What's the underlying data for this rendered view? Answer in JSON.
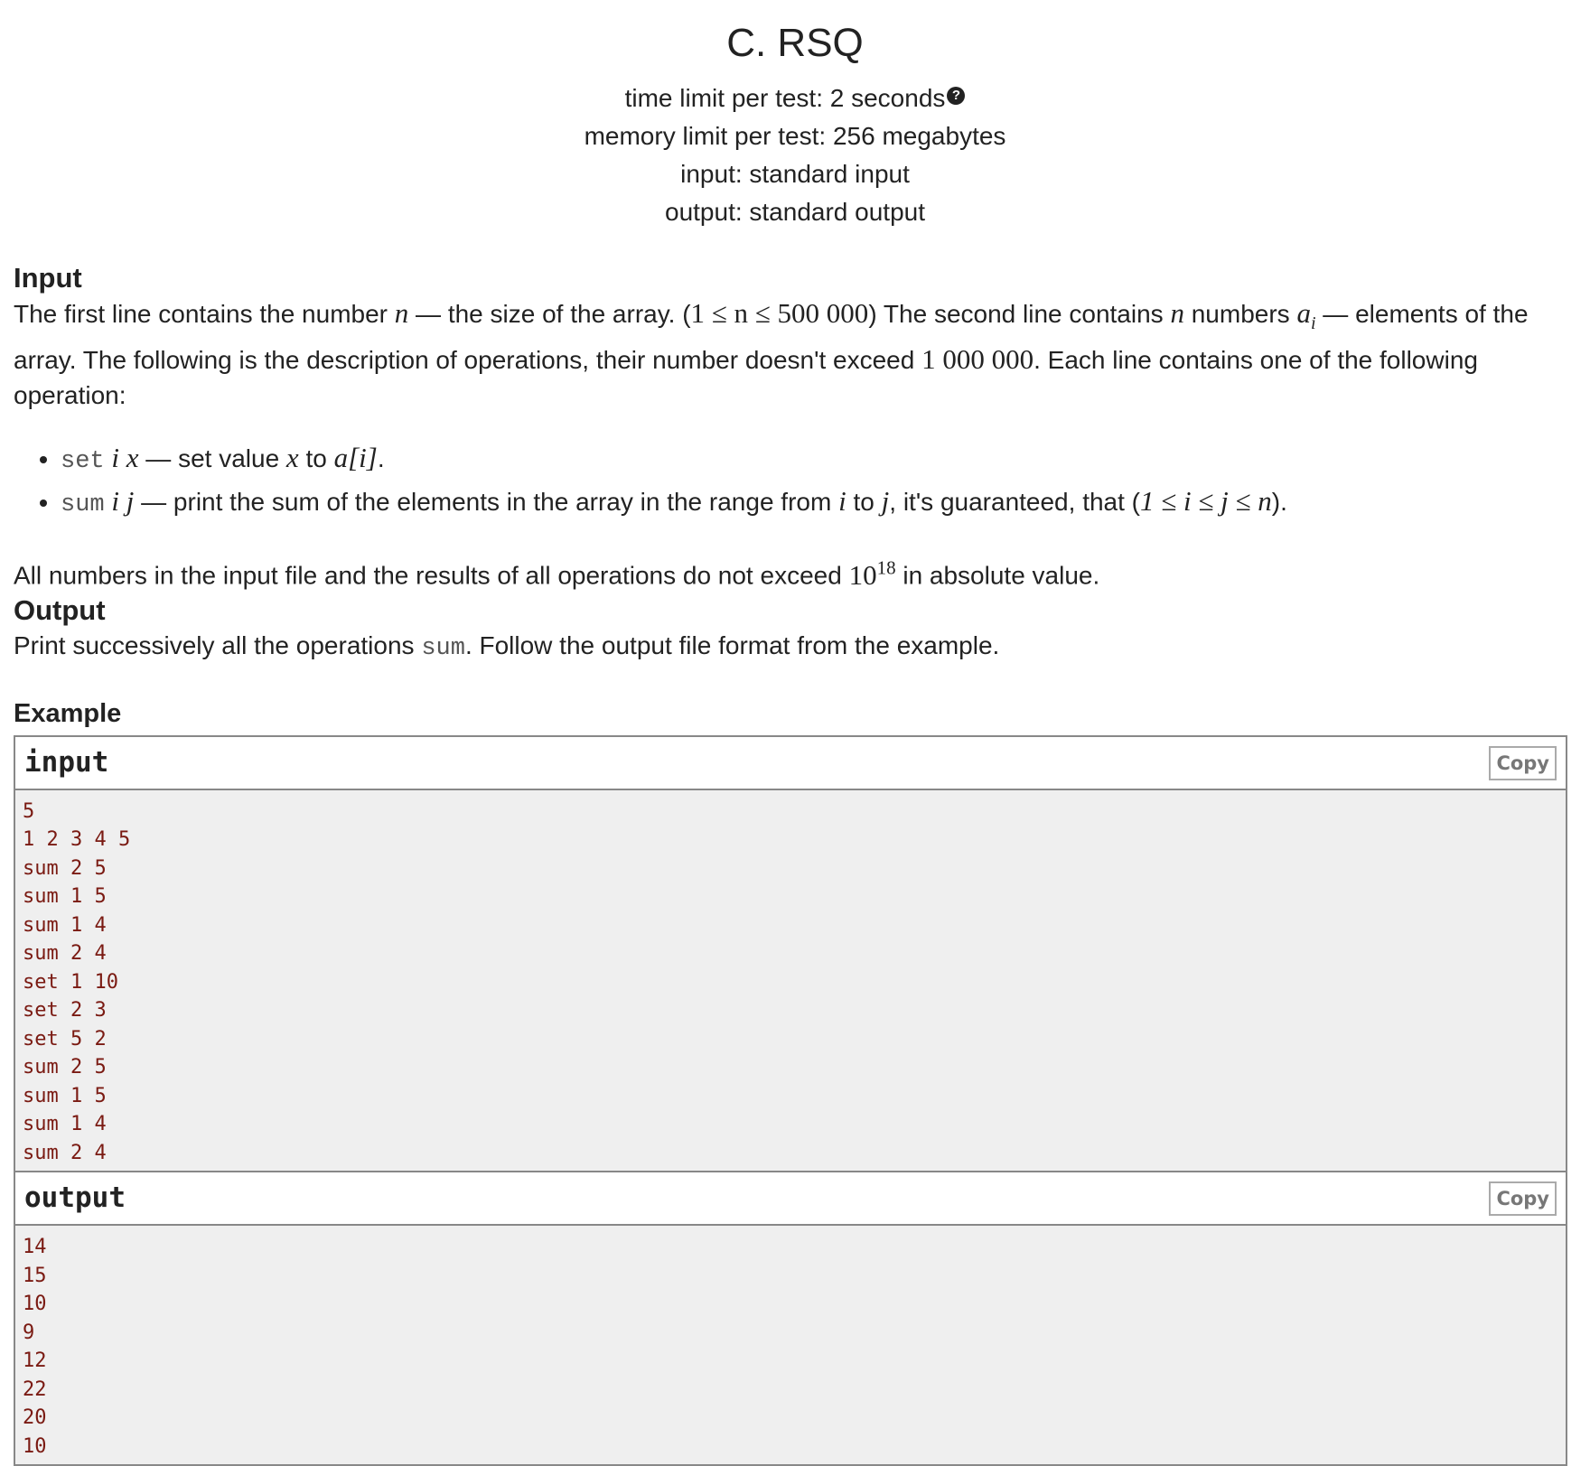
{
  "problem": {
    "title": "C. RSQ",
    "limits": {
      "time": "time limit per test: 2 seconds",
      "memory": "memory limit per test: 256 megabytes",
      "input": "input: standard input",
      "output": "output: standard output"
    },
    "help_icon": "question-circle-icon"
  },
  "input_section": {
    "title": "Input",
    "p1_a": "The first line contains the number ",
    "p1_b": " — the size of the array. (",
    "p1_c": ") The second line contains ",
    "p1_d": " numbers ",
    "p1_e": " — elements of the array. The following is the description of operations, their number doesn't exceed ",
    "p1_f": ". Each line contains one of the following operation:",
    "math_n": "n",
    "math_range": "1 ≤ n ≤ 500 000",
    "math_ai_base": "a",
    "math_ai_sub": "i",
    "math_limit": "1 000 000",
    "op1_cmd": "set",
    "op1_vars": "i x",
    "op1_text_a": " — set value ",
    "op1_x": "x",
    "op1_text_b": " to ",
    "op1_expr": "a[i]",
    "op1_end": ".",
    "op2_cmd": "sum",
    "op2_vars": "i j",
    "op2_text_a": " — print the sum of the elements in the array in the range from ",
    "op2_i": "i",
    "op2_text_b": " to ",
    "op2_j": "j",
    "op2_text_c": ", it's guaranteed, that (",
    "op2_cond": "1 ≤ i ≤ j ≤ n",
    "op2_end": ").",
    "p2_a": "All numbers in the input file and the results of all operations do not exceed ",
    "p2_base": "10",
    "p2_exp": "18",
    "p2_b": " in absolute value."
  },
  "output_section": {
    "title": "Output",
    "p_a": "Print successively all the operations ",
    "p_code": "sum",
    "p_b": ". Follow the output file format from the example."
  },
  "example": {
    "title": "Example",
    "input_label": "input",
    "output_label": "output",
    "copy_label": "Copy",
    "input_lines": [
      "5",
      "1 2 3 4 5",
      "sum 2 5",
      "sum 1 5",
      "sum 1 4",
      "sum 2 4",
      "set 1 10",
      "set 2 3",
      "set 5 2",
      "sum 2 5",
      "sum 1 5",
      "sum 1 4",
      "sum 2 4"
    ],
    "output_lines": [
      "14",
      "15",
      "10",
      "9",
      "12",
      "22",
      "20",
      "10"
    ]
  }
}
